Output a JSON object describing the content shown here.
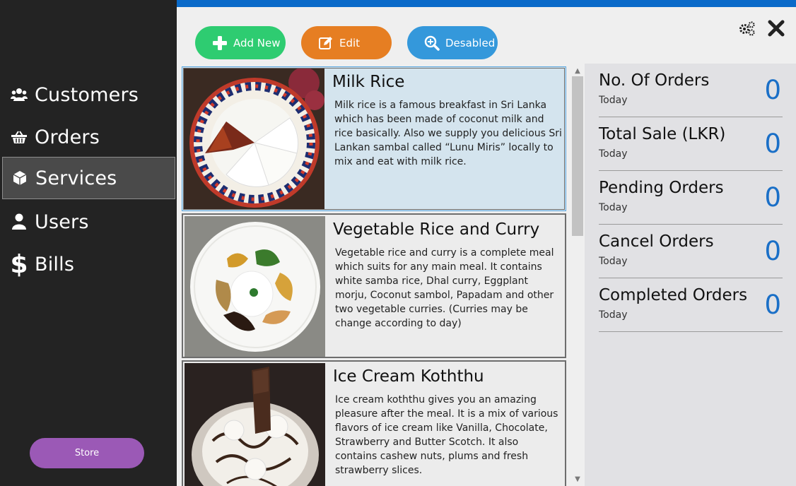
{
  "sidebar": {
    "items": [
      {
        "label": "Customers",
        "icon": "users-icon"
      },
      {
        "label": "Orders",
        "icon": "basket-icon"
      },
      {
        "label": "Services",
        "icon": "cube-icon"
      },
      {
        "label": "Users",
        "icon": "user-icon"
      },
      {
        "label": "Bills",
        "icon": "dollar-icon"
      }
    ],
    "active": "Services",
    "store_label": "Store"
  },
  "toolbar": {
    "add_label": "Add New",
    "edit_label": "Edit",
    "disabled_label": "Desabled"
  },
  "colors": {
    "sidebar_bg": "#232323",
    "accent_blue": "#0a6ac9",
    "add_green": "#2ecc71",
    "edit_orange": "#e67e22",
    "disabled_blue": "#3498db",
    "store_purple": "#9b59b6",
    "stat_value_blue": "#1a6fc7"
  },
  "services": [
    {
      "title": "Milk Rice",
      "description": "Milk rice is a famous breakfast in Sri Lanka which has been made of coconut milk and rice basically. Also we supply you delicious Sri Lankan sambal called “Lunu Miris” locally to mix and eat with milk rice."
    },
    {
      "title": "Vegetable Rice and Curry",
      "description": "Vegetable rice and curry is a complete meal which suits for any main meal. It contains white samba rice, Dhal curry, Eggplant morju, Coconut sambol, Papadam and other two vegetable curries. (Curries may be change according to day)"
    },
    {
      "title": "Ice Cream Koththu",
      "description": "Ice cream koththu gives you an amazing pleasure after the meal. It is a mix of various flavors of ice cream like Vanilla, Chocolate, Strawberry and Butter Scotch. It also contains cashew nuts, plums and fresh strawberry slices."
    }
  ],
  "stats": [
    {
      "label": "No. Of Orders",
      "sub": "Today",
      "value": "0"
    },
    {
      "label": "Total Sale (LKR)",
      "sub": "Today",
      "value": "0"
    },
    {
      "label": "Pending Orders",
      "sub": "Today",
      "value": "0"
    },
    {
      "label": "Cancel Orders",
      "sub": "Today",
      "value": "0"
    },
    {
      "label": "Completed Orders",
      "sub": "Today",
      "value": "0"
    }
  ]
}
